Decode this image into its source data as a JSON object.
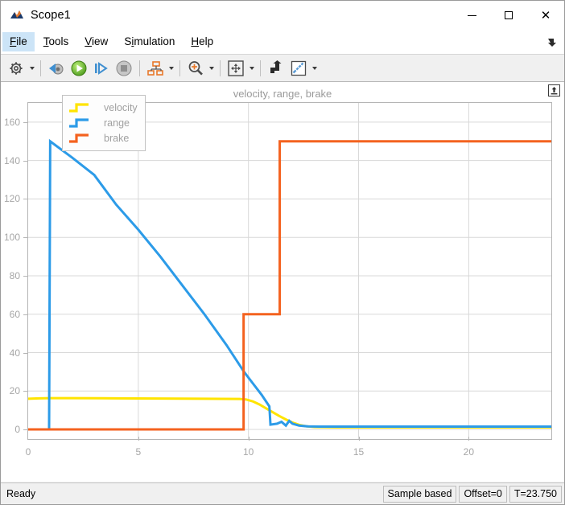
{
  "window": {
    "title": "Scope1",
    "app_icon": "matlab-scope-icon",
    "minimize_label": "—",
    "maximize_label": "□",
    "close_label": "✕"
  },
  "menu": {
    "items": [
      {
        "label": "File",
        "mnemonic": "F",
        "active": true
      },
      {
        "label": "Tools",
        "mnemonic": "T",
        "active": false
      },
      {
        "label": "View",
        "mnemonic": "V",
        "active": false
      },
      {
        "label": "Simulation",
        "mnemonic": "S",
        "active": false
      },
      {
        "label": "Help",
        "mnemonic": "H",
        "active": false
      }
    ],
    "undock_icon": "undock-arrow-icon"
  },
  "toolbar": {
    "buttons": [
      {
        "name": "configuration-properties-icon",
        "tip": "Configuration Properties",
        "caret": true
      },
      {
        "name": "rewind-to-start-icon",
        "tip": "Rewind to start",
        "caret": false
      },
      {
        "name": "run-icon",
        "tip": "Run",
        "caret": false
      },
      {
        "name": "step-forward-icon",
        "tip": "Step Forward",
        "caret": false
      },
      {
        "name": "stop-icon",
        "tip": "Stop",
        "caret": false
      },
      {
        "name": "signal-selection-icon",
        "tip": "Signal Selection",
        "caret": true
      },
      {
        "name": "zoom-in-icon",
        "tip": "Zoom In",
        "caret": true
      },
      {
        "name": "fit-to-view-icon",
        "tip": "Zoom to fit",
        "caret": true
      },
      {
        "name": "trigger-icon",
        "tip": "Trigger",
        "caret": false
      },
      {
        "name": "measurements-icon",
        "tip": "Measurements",
        "caret": true
      }
    ]
  },
  "scope": {
    "pin_icon": "pin-maximize-icon"
  },
  "status": {
    "ready": "Ready",
    "sample_mode": "Sample based",
    "offset": "Offset=0",
    "time": "T=23.750"
  },
  "chart_data": {
    "type": "line",
    "title": "velocity, range, brake",
    "xlabel": "",
    "ylabel": "",
    "xlim": [
      0,
      23.75
    ],
    "ylim": [
      -5,
      170
    ],
    "grid": true,
    "xticks": [
      0,
      5,
      10,
      15,
      20
    ],
    "yticks": [
      0,
      20,
      40,
      60,
      80,
      100,
      120,
      140,
      160
    ],
    "legend_position": "top-left",
    "colors": {
      "velocity": "#FFE400",
      "range": "#2C9BE8",
      "brake": "#F4621F"
    },
    "series": [
      {
        "name": "velocity",
        "color": "#FFE400",
        "points": [
          [
            0.0,
            16.0
          ],
          [
            0.5,
            16.2
          ],
          [
            1.0,
            16.3
          ],
          [
            2.0,
            16.3
          ],
          [
            4.0,
            16.2
          ],
          [
            6.0,
            16.1
          ],
          [
            8.0,
            16.0
          ],
          [
            9.6,
            15.9
          ],
          [
            9.9,
            15.6
          ],
          [
            10.2,
            14.6
          ],
          [
            10.5,
            13.0
          ],
          [
            10.8,
            11.0
          ],
          [
            11.1,
            9.0
          ],
          [
            11.4,
            7.0
          ],
          [
            11.7,
            5.2
          ],
          [
            12.0,
            3.6
          ],
          [
            12.3,
            2.4
          ],
          [
            12.6,
            1.7
          ],
          [
            13.0,
            1.3
          ],
          [
            14.0,
            1.1
          ],
          [
            16.0,
            1.1
          ],
          [
            20.0,
            1.1
          ],
          [
            23.75,
            1.1
          ]
        ]
      },
      {
        "name": "range",
        "color": "#2C9BE8",
        "points": [
          [
            0.0,
            0.0
          ],
          [
            0.95,
            0.0
          ],
          [
            1.0,
            150.0
          ],
          [
            2.0,
            141.5
          ],
          [
            3.0,
            132.5
          ],
          [
            4.0,
            117.0
          ],
          [
            5.0,
            104.0
          ],
          [
            6.0,
            90.0
          ],
          [
            7.0,
            75.0
          ],
          [
            8.0,
            60.0
          ],
          [
            9.0,
            44.0
          ],
          [
            9.8,
            30.0
          ],
          [
            10.2,
            24.0
          ],
          [
            10.6,
            18.0
          ],
          [
            10.95,
            12.0
          ],
          [
            11.0,
            2.5
          ],
          [
            11.3,
            3.0
          ],
          [
            11.5,
            4.0
          ],
          [
            11.7,
            2.0
          ],
          [
            11.85,
            4.5
          ],
          [
            12.0,
            3.0
          ],
          [
            12.3,
            2.0
          ],
          [
            12.7,
            1.6
          ],
          [
            13.2,
            1.5
          ],
          [
            15.0,
            1.5
          ],
          [
            18.0,
            1.5
          ],
          [
            21.0,
            1.5
          ],
          [
            23.75,
            1.5
          ]
        ]
      },
      {
        "name": "brake",
        "color": "#F4621F",
        "points": [
          [
            0.0,
            0.0
          ],
          [
            9.78,
            0.0
          ],
          [
            9.78,
            60.0
          ],
          [
            11.42,
            60.0
          ],
          [
            11.42,
            150.0
          ],
          [
            15.0,
            150.0
          ],
          [
            20.0,
            150.0
          ],
          [
            23.75,
            150.0
          ]
        ]
      }
    ]
  }
}
